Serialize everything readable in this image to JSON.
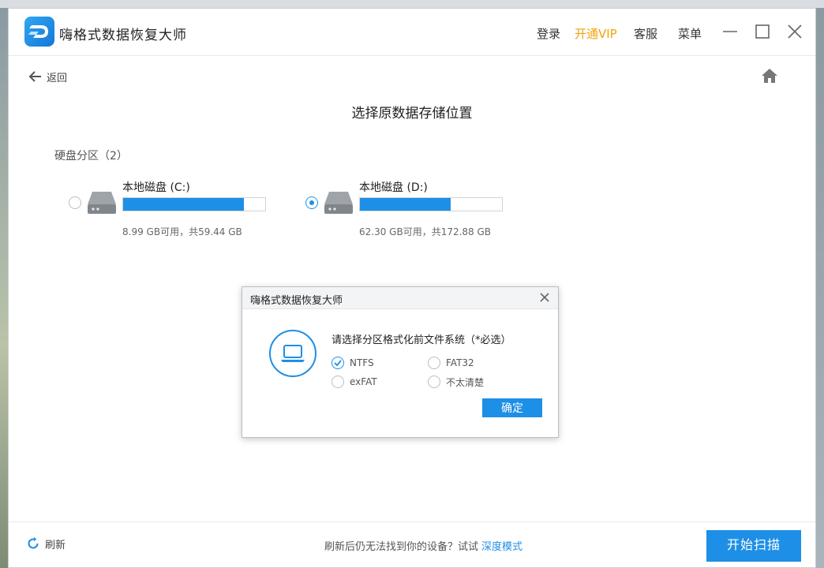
{
  "app": {
    "title": "嗨格式数据恢复大师",
    "menu": {
      "login": "登录",
      "vip": "开通VIP",
      "service": "客服",
      "menu": "菜单"
    }
  },
  "nav": {
    "back_label": "返回"
  },
  "page": {
    "title": "选择原数据存储位置",
    "section_label": "硬盘分区（2）"
  },
  "disks": [
    {
      "name": "本地磁盘 (C:)",
      "size_text": "8.99 GB可用，共59.44 GB",
      "used_fraction": 0.85,
      "selected": false
    },
    {
      "name": "本地磁盘 (D:)",
      "size_text": "62.30 GB可用，共172.88 GB",
      "used_fraction": 0.64,
      "selected": true
    }
  ],
  "dialog": {
    "title": "嗨格式数据恢复大师",
    "prompt": "请选择分区格式化前文件系统（*必选）",
    "options": [
      {
        "label": "NTFS",
        "checked": true
      },
      {
        "label": "FAT32",
        "checked": false
      },
      {
        "label": "exFAT",
        "checked": false
      },
      {
        "label": "不太清楚",
        "checked": false
      }
    ],
    "confirm_label": "确定"
  },
  "footer": {
    "refresh_label": "刷新",
    "hint": "刷新后仍无法找到你的设备？试试",
    "deep_mode_label": "深度模式",
    "start_label": "开始扫描"
  },
  "colors": {
    "accent": "#1e8fe6",
    "vip": "#f0a30a"
  },
  "icons": {
    "logo": "app-logo-icon",
    "back": "arrow-left-icon",
    "home": "home-icon",
    "drive": "hard-drive-icon",
    "laptop": "laptop-icon",
    "refresh": "refresh-icon"
  }
}
